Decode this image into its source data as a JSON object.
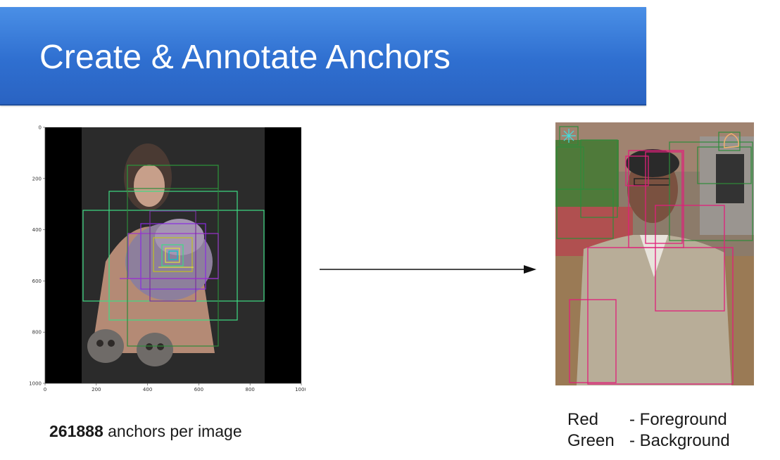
{
  "slide": {
    "title": "Create & Annotate Anchors",
    "anchor_count_number": "261888",
    "anchor_count_text": " anchors per image",
    "legend": [
      {
        "key": "Red",
        "desc": "- Foreground"
      },
      {
        "key": "Green",
        "desc": "- Background"
      }
    ],
    "colors": {
      "title_bar": "#3478da",
      "foreground_box": "#e0207a",
      "background_box": "#2e8b3a"
    }
  },
  "left_plot": {
    "x_ticks": [
      "0",
      "200",
      "400",
      "600",
      "800",
      "1000"
    ],
    "y_ticks": [
      "0",
      "200",
      "400",
      "600",
      "800",
      "1000"
    ]
  }
}
